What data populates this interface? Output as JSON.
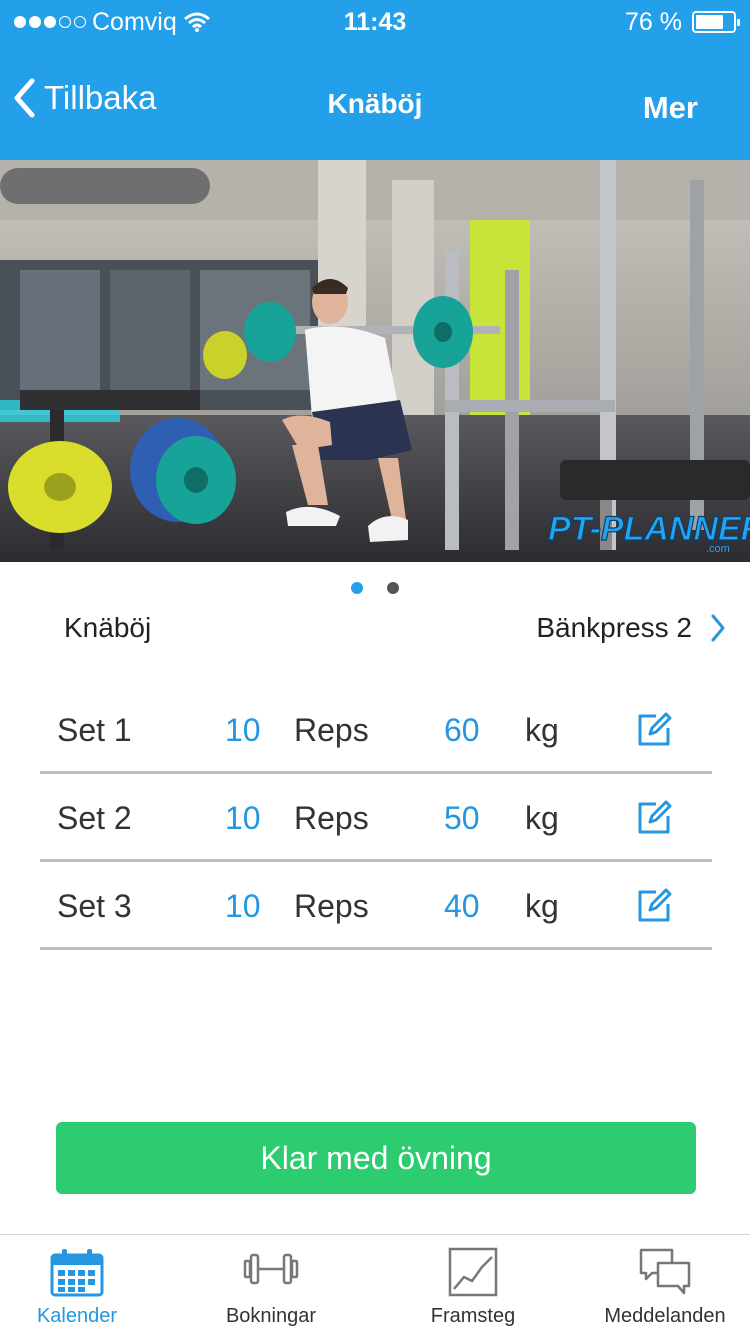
{
  "status_bar": {
    "carrier": "Comviq",
    "time": "11:43",
    "battery": "76 %",
    "battery_level": 0.76
  },
  "nav": {
    "back_label": "Tillbaka",
    "title": "Knäböj",
    "more_label": "Mer"
  },
  "hero": {
    "logo_text": "PT-PLANNER",
    "logo_sub": ".com"
  },
  "pager": {
    "count": 2,
    "active": 0
  },
  "exercise": {
    "current": "Knäböj",
    "next": "Bänkpress 2"
  },
  "sets": [
    {
      "label": "Set 1",
      "reps": "10",
      "reps_unit": "Reps",
      "weight": "60",
      "weight_unit": "kg"
    },
    {
      "label": "Set 2",
      "reps": "10",
      "reps_unit": "Reps",
      "weight": "50",
      "weight_unit": "kg"
    },
    {
      "label": "Set 3",
      "reps": "10",
      "reps_unit": "Reps",
      "weight": "40",
      "weight_unit": "kg"
    }
  ],
  "done_button": "Klar med övning",
  "tabs": [
    {
      "label": "Kalender",
      "icon": "calendar-icon",
      "active": true
    },
    {
      "label": "Bokningar",
      "icon": "dumbbell-icon",
      "active": false
    },
    {
      "label": "Framsteg",
      "icon": "chart-icon",
      "active": false
    },
    {
      "label": "Meddelanden",
      "icon": "messages-icon",
      "active": false
    }
  ],
  "colors": {
    "primary": "#24a0ea",
    "accent_value": "#2596e0",
    "done": "#2ecc71"
  }
}
